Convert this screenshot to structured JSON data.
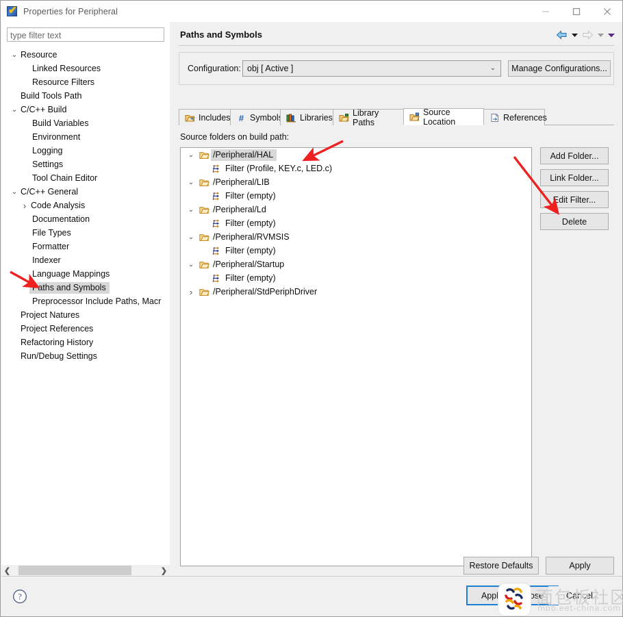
{
  "window": {
    "title": "Properties for Peripheral",
    "app_icon": "checkbox-icon",
    "minimize_label": "Minimize",
    "maximize_label": "Maximize",
    "close_label": "Close"
  },
  "sidebar": {
    "filter_placeholder": "type filter text",
    "filter_value": "",
    "items": [
      {
        "label": "Resource",
        "level": 0,
        "twisty": "down",
        "selected": false
      },
      {
        "label": "Linked Resources",
        "level": 1,
        "twisty": "",
        "selected": false
      },
      {
        "label": "Resource Filters",
        "level": 1,
        "twisty": "",
        "selected": false
      },
      {
        "label": "Build Tools Path",
        "level": 0,
        "twisty": "",
        "selected": false
      },
      {
        "label": "C/C++ Build",
        "level": 0,
        "twisty": "down",
        "selected": false
      },
      {
        "label": "Build Variables",
        "level": 1,
        "twisty": "",
        "selected": false
      },
      {
        "label": "Environment",
        "level": 1,
        "twisty": "",
        "selected": false
      },
      {
        "label": "Logging",
        "level": 1,
        "twisty": "",
        "selected": false
      },
      {
        "label": "Settings",
        "level": 1,
        "twisty": "",
        "selected": false
      },
      {
        "label": "Tool Chain Editor",
        "level": 1,
        "twisty": "",
        "selected": false
      },
      {
        "label": "C/C++ General",
        "level": 0,
        "twisty": "down",
        "selected": false
      },
      {
        "label": "Code Analysis",
        "level": 1,
        "twisty": "right",
        "selected": false
      },
      {
        "label": "Documentation",
        "level": 1,
        "twisty": "",
        "selected": false
      },
      {
        "label": "File Types",
        "level": 1,
        "twisty": "",
        "selected": false
      },
      {
        "label": "Formatter",
        "level": 1,
        "twisty": "",
        "selected": false
      },
      {
        "label": "Indexer",
        "level": 1,
        "twisty": "",
        "selected": false
      },
      {
        "label": "Language Mappings",
        "level": 1,
        "twisty": "",
        "selected": false
      },
      {
        "label": "Paths and Symbols",
        "level": 1,
        "twisty": "",
        "selected": true
      },
      {
        "label": "Preprocessor Include Paths, Macr",
        "level": 1,
        "twisty": "",
        "selected": false
      },
      {
        "label": "Project Natures",
        "level": 0,
        "twisty": "",
        "selected": false
      },
      {
        "label": "Project References",
        "level": 0,
        "twisty": "",
        "selected": false
      },
      {
        "label": "Refactoring History",
        "level": 0,
        "twisty": "",
        "selected": false
      },
      {
        "label": "Run/Debug Settings",
        "level": 0,
        "twisty": "",
        "selected": false
      }
    ],
    "scroll_left_icon": "chevron-left-icon",
    "scroll_right_icon": "chevron-right-icon"
  },
  "content": {
    "page_title": "Paths and Symbols",
    "nav": {
      "back_icon": "back-arrow-icon",
      "back_menu_icon": "chevron-down-icon",
      "forward_icon": "forward-arrow-icon",
      "forward_menu_icon": "chevron-down-icon",
      "overflow_icon": "chevron-down-icon"
    },
    "configuration": {
      "label": "Configuration:",
      "value": "obj  [ Active ]",
      "dropdown_icon": "chevron-down-icon",
      "manage_button": "Manage Configurations..."
    },
    "tabs": [
      {
        "label": "Includes",
        "icon": "includes-icon",
        "active": false
      },
      {
        "label": "Symbols",
        "icon": "hash-icon",
        "active": false
      },
      {
        "label": "Libraries",
        "icon": "libraries-icon",
        "active": false
      },
      {
        "label": "Library Paths",
        "icon": "library-paths-icon",
        "active": false
      },
      {
        "label": "Source Location",
        "icon": "source-folder-icon",
        "active": true
      },
      {
        "label": "References",
        "icon": "references-icon",
        "active": false
      }
    ],
    "source_folders_label": "Source folders on build path:",
    "tree": [
      {
        "type": "folder",
        "label": "/Peripheral/HAL",
        "twisty": "down",
        "selected": true
      },
      {
        "type": "filter",
        "label": "Filter (Profile, KEY.c, LED.c)",
        "twisty": "",
        "selected": false
      },
      {
        "type": "folder",
        "label": "/Peripheral/LIB",
        "twisty": "down",
        "selected": false
      },
      {
        "type": "filter",
        "label": "Filter (empty)",
        "twisty": "",
        "selected": false
      },
      {
        "type": "folder",
        "label": "/Peripheral/Ld",
        "twisty": "down",
        "selected": false
      },
      {
        "type": "filter",
        "label": "Filter (empty)",
        "twisty": "",
        "selected": false
      },
      {
        "type": "folder",
        "label": "/Peripheral/RVMSIS",
        "twisty": "down",
        "selected": false
      },
      {
        "type": "filter",
        "label": "Filter (empty)",
        "twisty": "",
        "selected": false
      },
      {
        "type": "folder",
        "label": "/Peripheral/Startup",
        "twisty": "down",
        "selected": false
      },
      {
        "type": "filter",
        "label": "Filter (empty)",
        "twisty": "",
        "selected": false
      },
      {
        "type": "folder",
        "label": "/Peripheral/StdPeriphDriver",
        "twisty": "right",
        "selected": false
      }
    ],
    "side_buttons": [
      {
        "label": "Add Folder..."
      },
      {
        "label": "Link Folder..."
      },
      {
        "label": "Edit Filter..."
      },
      {
        "label": "Delete"
      }
    ],
    "restore_defaults": "Restore Defaults",
    "apply": "Apply"
  },
  "footer": {
    "help_icon": "help-icon",
    "apply_and_close": "Apply and Close",
    "cancel": "Cancel"
  },
  "watermark": {
    "text": "面包板社区",
    "subtext": "mbb.eet-china.com"
  },
  "colors": {
    "accent_blue": "#1d7fd4",
    "annotation_red": "#ee2020",
    "selection_gray": "#d8d8d8",
    "folder_gold": "#e8a33d"
  }
}
